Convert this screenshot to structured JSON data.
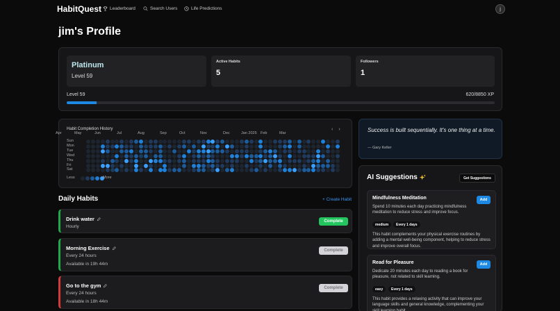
{
  "nav": {
    "logo": "HabitQuest",
    "links": [
      {
        "label": "Leaderboard",
        "icon": "trophy-icon"
      },
      {
        "label": "Search Users",
        "icon": "search-icon"
      },
      {
        "label": "Life Predictions",
        "icon": "clock-icon"
      }
    ],
    "user_initial": "j"
  },
  "profile": {
    "title": "jim's Profile"
  },
  "stats": {
    "tier": "Platinum",
    "level_text": "Level 59",
    "active_habits_label": "Active Habits",
    "active_habits": "5",
    "followers_label": "Followers",
    "followers": "1",
    "xp_level": "Level 59",
    "xp_text": "620/8850 XP",
    "xp_progress": 0.07
  },
  "heatmap": {
    "title": "Habit Completion History",
    "months": [
      "Apr",
      "May",
      "Jun",
      "Jul",
      "Aug",
      "Sep",
      "Oct",
      "Nov",
      "Dec",
      "Jan 2025",
      "Feb",
      "Mar"
    ],
    "days": [
      "Sun",
      "Mon",
      "Tue",
      "Wed",
      "Thu",
      "Fri",
      "Sat"
    ],
    "legend_less": "Less",
    "legend_more": "More",
    "colors": [
      "#1d2630",
      "#1f3a5c",
      "#1c5c9a",
      "#1e80d8",
      "#3aa0ff"
    ],
    "prev": "‹",
    "next": "›"
  },
  "daily": {
    "title": "Daily Habits",
    "create_label": "+ Create Habit",
    "habits": [
      {
        "name": "Drink water",
        "frequency": "Hourly",
        "available": "",
        "button": "Complete",
        "color": "#21a84b",
        "enabled": true
      },
      {
        "name": "Morning Exercise",
        "frequency": "Every 24 hours",
        "available": "Available in 19h 44m",
        "button": "Complete",
        "color": "#21a84b",
        "enabled": false
      },
      {
        "name": "Go to the gym",
        "frequency": "Every 24 hours",
        "available": "Available in 18h 44m",
        "button": "Complete",
        "color": "#d23b3b",
        "enabled": false
      }
    ]
  },
  "quote": {
    "text": "Success is built sequentially. It's one thing at a time.",
    "author": "— Gary Keller"
  },
  "ai": {
    "title": "AI Suggestions",
    "get_label": "Get Suggestions",
    "suggestions": [
      {
        "name": "Mindfulness Meditation",
        "description": "Spend 10 minutes each day practicing mindfulness meditation to reduce stress and improve focus.",
        "add": "Add",
        "difficulty": "medium",
        "frequency": "Every 1 days",
        "reason": "This habit complements your physical exercise routines by adding a mental well-being component, helping to reduce stress and improve overall focus."
      },
      {
        "name": "Read for Pleasure",
        "description": "Dedicate 20 minutes each day to reading a book for pleasure, not related to skill learning.",
        "add": "Add",
        "difficulty": "easy",
        "frequency": "Every 1 days",
        "reason": "This habit provides a relaxing activity that can improve your language skills and general knowledge, complementing your skill learning habit."
      }
    ]
  }
}
